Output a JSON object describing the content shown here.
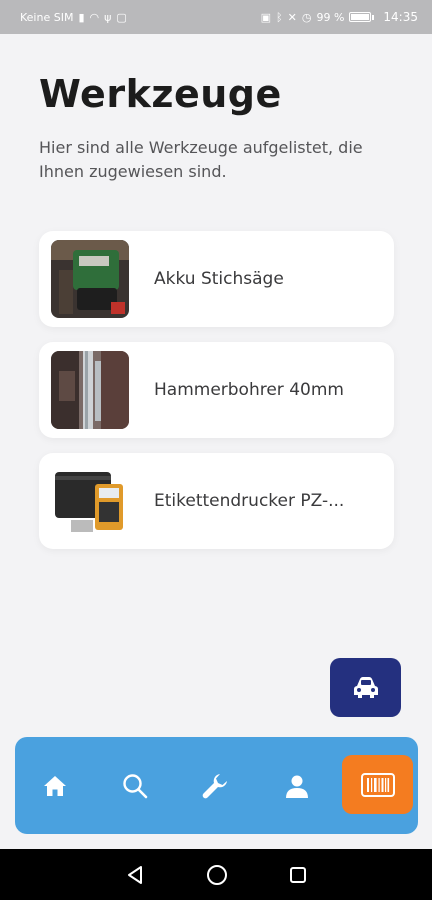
{
  "status_bar": {
    "carrier": "Keine SIM",
    "battery_percent": "99 %",
    "battery_level": 0.99,
    "time": "14:35"
  },
  "header": {
    "title": "Werkzeuge",
    "subtitle": "Hier sind alle Werkzeuge aufgelistet, die Ihnen zugewiesen sind."
  },
  "tools": [
    {
      "name": "Akku Stichsäge"
    },
    {
      "name": "Hammerbohrer 40mm"
    },
    {
      "name": "Etikettendrucker PZ-..."
    }
  ],
  "fab": {
    "icon": "car-icon"
  },
  "bottom_nav": {
    "items": [
      {
        "icon": "home-icon"
      },
      {
        "icon": "search-icon"
      },
      {
        "icon": "wrench-icon"
      },
      {
        "icon": "person-icon"
      },
      {
        "icon": "barcode-icon"
      }
    ]
  },
  "colors": {
    "primary_dark": "#24307f",
    "nav_blue": "#4aa1df",
    "accent_orange": "#f47c20",
    "background": "#f3f3f5"
  }
}
